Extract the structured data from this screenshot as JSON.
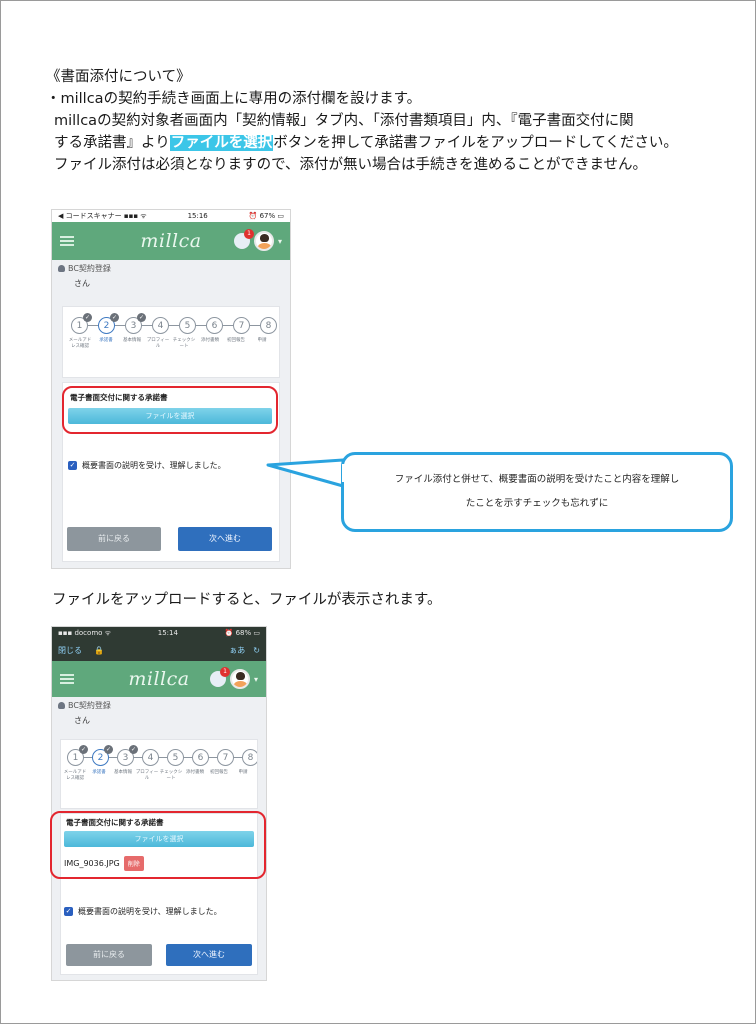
{
  "intro": {
    "heading": "《書面添付について》",
    "line1": "・millcaの契約手続き画面上に専用の添付欄を設けます。",
    "line2": "millcaの契約対象者画面内「契約情報」タブ内、「添付書類項目」内、『電子書面交付に関",
    "line3_before": "する承諾書』より",
    "line3_highlight": "ファイルを選択",
    "line3_after": "ボタンを押して承諾書ファイルをアップロードしてください。",
    "line4": "ファイル添付は必須となりますので、添付が無い場合は手続きを進めることができません。"
  },
  "phone1": {
    "status_left": "◀ コードスキャナー ▪▪▪ ᯤ",
    "status_time": "15:16",
    "status_right": "⏰ 67% ▭",
    "brand": "millca",
    "badge": "1",
    "section_title": "BC契約登録",
    "user_name": "さん",
    "doc_title": "電子書面交付に関する承諾書",
    "file_button": "ファイルを選択",
    "check_label": "概要書面の説明を受け、理解しました。",
    "back_button": "前に戻る",
    "next_button": "次へ進む"
  },
  "steps": {
    "numbers": [
      "1",
      "2",
      "3",
      "4",
      "5",
      "6",
      "7",
      "8"
    ],
    "labels": [
      "メールアドレス確認",
      "承諾書",
      "基本情報",
      "プロフィール",
      "チェックシート",
      "添付書類",
      "初回報告",
      "申請"
    ]
  },
  "callout": {
    "line1": "ファイル添付と併せて、概要書面の説明を受けたこと内容を理解し",
    "line2": "たことを示すチェックも忘れずに"
  },
  "mid_caption": "ファイルをアップロードすると、ファイルが表示されます。",
  "phone2": {
    "status_left": "▪▪▪ docomo ᯤ",
    "status_time": "15:14",
    "status_right": "⏰ 68% ▭",
    "browser_close": "閉じる",
    "browser_lock": "🔒",
    "browser_text_size": "ぁあ",
    "browser_reload": "↻",
    "brand": "millca",
    "badge": "1",
    "section_title": "BC契約登録",
    "user_name": "さん",
    "doc_title": "電子書面交付に関する承諾書",
    "file_button": "ファイルを選択",
    "file_name": "IMG_9036.JPG",
    "delete_button": "削除",
    "check_label": "概要書面の説明を受け、理解しました。",
    "back_button": "前に戻る",
    "next_button": "次へ進む"
  },
  "colors": {
    "appbar": "#5fa87c",
    "highlight": "#3cc6e8",
    "frame_red": "#e3262f",
    "callout_blue": "#2aa3df",
    "next_button": "#2f6fbd"
  }
}
